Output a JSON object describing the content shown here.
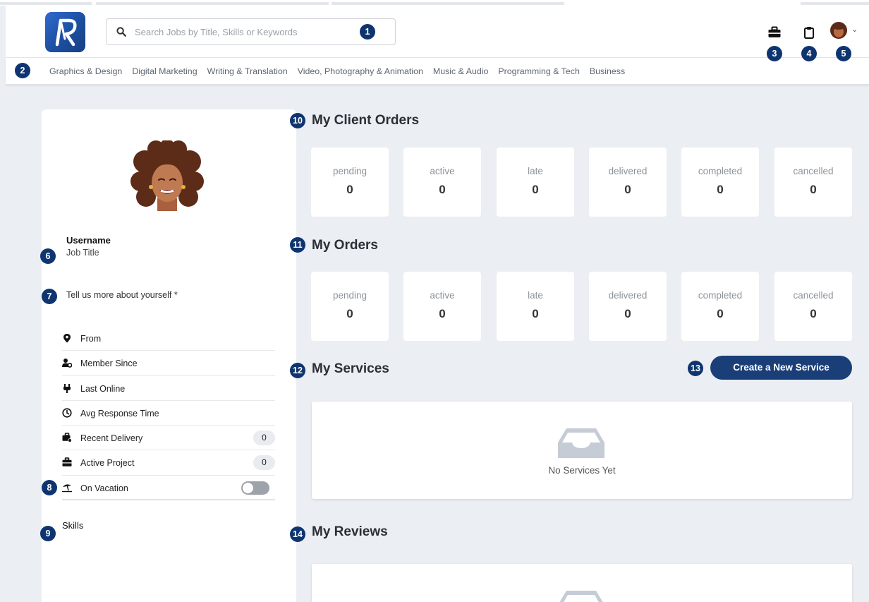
{
  "header": {
    "search_placeholder": "Search Jobs by Title, Skills or Keywords"
  },
  "categories": [
    "Graphics & Design",
    "Digital Marketing",
    "Writing & Translation",
    "Video, Photography & Animation",
    "Music & Audio",
    "Programming & Tech",
    "Business"
  ],
  "profile": {
    "username": "Username",
    "job_title": "Job Title",
    "about_prompt": "Tell us more about yourself *",
    "stats": [
      {
        "icon": "location-pin-icon",
        "label": "From"
      },
      {
        "icon": "member-icon",
        "label": "Member Since"
      },
      {
        "icon": "plug-icon",
        "label": "Last Online"
      },
      {
        "icon": "clock-icon",
        "label": "Avg Response Time"
      },
      {
        "icon": "delivery-icon",
        "label": "Recent Delivery",
        "count": "0"
      },
      {
        "icon": "briefcase-icon",
        "label": "Active Project",
        "count": "0"
      },
      {
        "icon": "beach-umbrella-icon",
        "label": "On Vacation",
        "toggle": false
      }
    ],
    "skills_label": "Skills"
  },
  "client_orders": {
    "title": "My Client Orders",
    "cards": [
      {
        "label": "pending",
        "value": "0"
      },
      {
        "label": "active",
        "value": "0"
      },
      {
        "label": "late",
        "value": "0"
      },
      {
        "label": "delivered",
        "value": "0"
      },
      {
        "label": "completed",
        "value": "0"
      },
      {
        "label": "cancelled",
        "value": "0"
      }
    ]
  },
  "my_orders": {
    "title": "My Orders",
    "cards": [
      {
        "label": "pending",
        "value": "0"
      },
      {
        "label": "active",
        "value": "0"
      },
      {
        "label": "late",
        "value": "0"
      },
      {
        "label": "delivered",
        "value": "0"
      },
      {
        "label": "completed",
        "value": "0"
      },
      {
        "label": "cancelled",
        "value": "0"
      }
    ]
  },
  "services": {
    "title": "My Services",
    "create_button": "Create a New Service",
    "empty_text": "No Services Yet"
  },
  "reviews": {
    "title": "My Reviews"
  },
  "markers": [
    "1",
    "2",
    "3",
    "4",
    "5",
    "6",
    "7",
    "8",
    "9",
    "10",
    "11",
    "12",
    "13",
    "14"
  ],
  "colors": {
    "accent": "#1a3f78",
    "marker": "#0f3570",
    "background": "#ebeef3"
  }
}
